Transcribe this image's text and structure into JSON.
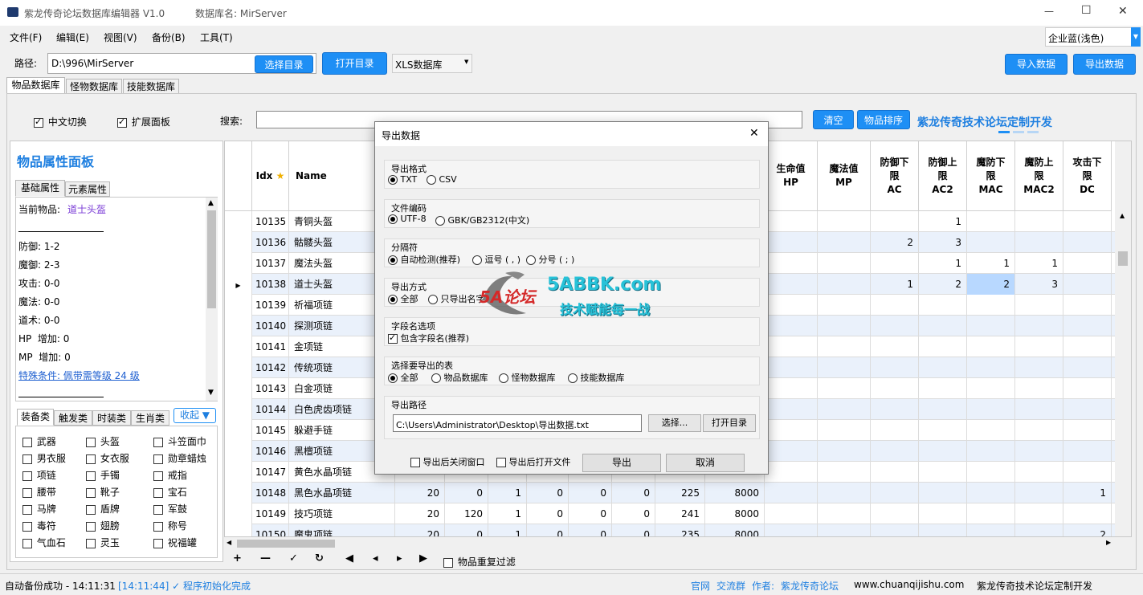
{
  "window": {
    "title": "紫龙传奇论坛数据库编辑器 V1.0",
    "db_label": "数据库名: MirServer",
    "min": "—",
    "max": "☐",
    "close": "✕"
  },
  "menu": [
    "文件(F)",
    "编辑(E)",
    "视图(V)",
    "备份(B)",
    "工具(T)"
  ],
  "theme": {
    "value": "企业蓝(浅色)",
    "accent": "#1e8ff5"
  },
  "toolbar": {
    "path_label": "路径:",
    "path_value": "D:\\996\\MirServer",
    "choose_dir": "选择目录",
    "open_dir": "打开目录",
    "db_type": "XLS数据库",
    "import": "导入数据",
    "export": "导出数据"
  },
  "tabs": [
    "物品数据库",
    "怪物数据库",
    "技能数据库"
  ],
  "options": {
    "cn_switch": "中文切换",
    "ext_panel": "扩展面板",
    "search_label": "搜索:",
    "clear": "清空",
    "sort": "物品排序",
    "promo": "紫龙传奇技术论坛定制开发"
  },
  "panel": {
    "title": "物品属性面板",
    "tabs": [
      "基础属性",
      "元素属性"
    ],
    "current_label": "当前物品:",
    "current_value": "道士头盔",
    "lines": [
      "防御: 1-2",
      "魔御: 2-3",
      "攻击: 0-0",
      "魔法: 0-0",
      "道术: 0-0",
      "HP  增加: 0",
      "MP  增加: 0"
    ],
    "special": "特殊条件: 佩带需等级 24 级",
    "cat_tabs": [
      "装备类",
      "触发类",
      "时装类",
      "生肖类"
    ],
    "collapse": "收起 ▼",
    "cats": [
      [
        "武器",
        "头盔",
        "斗笠面巾"
      ],
      [
        "男衣服",
        "女衣服",
        "勋章蜡烛"
      ],
      [
        "项链",
        "手镯",
        "戒指"
      ],
      [
        "腰带",
        "靴子",
        "宝石"
      ],
      [
        "马牌",
        "盾牌",
        "军鼓"
      ],
      [
        "毒符",
        "翅膀",
        "称号"
      ],
      [
        "气血石",
        "灵玉",
        "祝福罐"
      ]
    ]
  },
  "grid": {
    "idx_header": "Idx",
    "star": "★",
    "name_header": "Name",
    "right_headers": [
      "生命值\nHP",
      "魔法值\nMP",
      "防御下\n限\nAC",
      "防御上\n限\nAC2",
      "魔防下\n限\nMAC",
      "魔防上\n限\nMAC2",
      "攻击下\n限\nDC"
    ],
    "rows": [
      {
        "idx": "10135",
        "name": "青铜头盔",
        "c": [
          "",
          "",
          "",
          "",
          "",
          "",
          "",
          "",
          ""
        ],
        "r": [
          "",
          "",
          "",
          "1",
          "",
          "",
          ""
        ]
      },
      {
        "idx": "10136",
        "name": "骷髅头盔",
        "c": [
          "",
          "",
          "",
          "",
          "",
          "",
          "",
          "",
          ""
        ],
        "r": [
          "",
          "",
          "2",
          "3",
          "",
          "",
          ""
        ]
      },
      {
        "idx": "10137",
        "name": "魔法头盔",
        "c": [
          "",
          "",
          "",
          "",
          "",
          "",
          "",
          "",
          ""
        ],
        "r": [
          "",
          "",
          "",
          "1",
          "1",
          "1",
          ""
        ]
      },
      {
        "idx": "10138",
        "name": "道士头盔",
        "c": [
          "",
          "",
          "",
          "",
          "",
          "",
          "",
          "",
          ""
        ],
        "r": [
          "",
          "",
          "1",
          "2",
          "2",
          "3",
          ""
        ],
        "current": true
      },
      {
        "idx": "10139",
        "name": "祈福项链",
        "c": [
          "",
          "",
          "",
          "",
          "",
          "",
          "",
          "",
          ""
        ],
        "r": [
          "",
          "",
          "",
          "",
          "",
          "",
          ""
        ]
      },
      {
        "idx": "10140",
        "name": "探测项链",
        "c": [
          "",
          "",
          "",
          "",
          "",
          "",
          "",
          "",
          ""
        ],
        "r": [
          "",
          "",
          "",
          "",
          "",
          "",
          ""
        ]
      },
      {
        "idx": "10141",
        "name": "金项链",
        "c": [
          "",
          "",
          "",
          "",
          "",
          "",
          "",
          "",
          ""
        ],
        "r": [
          "",
          "",
          "",
          "",
          "",
          "",
          ""
        ]
      },
      {
        "idx": "10142",
        "name": "传统项链",
        "c": [
          "",
          "",
          "",
          "",
          "",
          "",
          "",
          "",
          ""
        ],
        "r": [
          "",
          "",
          "",
          "",
          "",
          "",
          ""
        ]
      },
      {
        "idx": "10143",
        "name": "白金项链",
        "c": [
          "",
          "",
          "",
          "",
          "",
          "",
          "",
          "",
          ""
        ],
        "r": [
          "",
          "",
          "",
          "",
          "",
          "",
          ""
        ]
      },
      {
        "idx": "10144",
        "name": "白色虎齿项链",
        "c": [
          "",
          "",
          "",
          "",
          "",
          "",
          "",
          "",
          ""
        ],
        "r": [
          "",
          "",
          "",
          "",
          "",
          "",
          ""
        ]
      },
      {
        "idx": "10145",
        "name": "躲避手链",
        "c": [
          "",
          "",
          "",
          "",
          "",
          "",
          "",
          "",
          ""
        ],
        "r": [
          "",
          "",
          "",
          "",
          "",
          "",
          ""
        ]
      },
      {
        "idx": "10146",
        "name": "黑檀项链",
        "c": [
          "",
          "",
          "",
          "",
          "",
          "",
          "",
          "",
          ""
        ],
        "r": [
          "",
          "",
          "",
          "",
          "",
          "",
          ""
        ]
      },
      {
        "idx": "10147",
        "name": "黄色水晶项链",
        "c": [
          "",
          "",
          "",
          "",
          "",
          "",
          "",
          "",
          ""
        ],
        "r": [
          "",
          "",
          "",
          "",
          "",
          "",
          ""
        ]
      },
      {
        "idx": "10148",
        "name": "黑色水晶项链",
        "c": [
          "20",
          "0",
          "1",
          "0",
          "0",
          "0",
          "225",
          "8000",
          ""
        ],
        "r": [
          "",
          "",
          "",
          "",
          "",
          "",
          "1"
        ]
      },
      {
        "idx": "10149",
        "name": "技巧项链",
        "c": [
          "20",
          "120",
          "1",
          "0",
          "0",
          "0",
          "241",
          "8000",
          ""
        ],
        "r": [
          "",
          "",
          "",
          "",
          "",
          "",
          ""
        ]
      },
      {
        "idx": "10150",
        "name": "魔鬼项链",
        "c": [
          "20",
          "0",
          "1",
          "0",
          "0",
          "0",
          "235",
          "8000",
          ""
        ],
        "r": [
          "",
          "",
          "",
          "",
          "",
          "",
          "2"
        ]
      }
    ]
  },
  "bottom_toolbar": {
    "buttons": [
      "+",
      "—",
      "✓",
      "↻",
      "◀",
      "◂",
      "▸",
      "▶"
    ],
    "dup_filter": "物品重复过滤"
  },
  "status": {
    "left": "自动备份成功 - 14:11:31",
    "log": "[14:11:44] ✓ 程序初始化完成",
    "links": [
      "官网",
      "交流群"
    ],
    "author": "作者:",
    "author_link": "紫龙传奇论坛",
    "site": "www.chuanqijishu.com",
    "promo": "紫龙传奇技术论坛定制开发"
  },
  "watermark": {
    "logo": "5A论坛",
    "site": "5ABBK.com",
    "slogan": "技术赋能每一战"
  },
  "dialog": {
    "title": "导出数据",
    "close": "✕",
    "format_label": "导出格式",
    "format_opts": [
      "TXT",
      "CSV"
    ],
    "enc_label": "文件编码",
    "enc_opts": [
      "UTF-8",
      "GBK/GB2312(中文)"
    ],
    "sep_label": "分隔符",
    "sep_opts": [
      "自动检测(推荐)",
      "逗号 ( , )",
      "分号 ( ; )"
    ],
    "mode_label": "导出方式",
    "mode_opts": [
      "全部",
      "只导出名字"
    ],
    "field_label": "字段名选项",
    "field_opt": "包含字段名(推荐)",
    "table_label": "选择要导出的表",
    "table_opts": [
      "全部",
      "物品数据库",
      "怪物数据库",
      "技能数据库"
    ],
    "path_label": "导出路径",
    "path_value": "C:\\Users\\Administrator\\Desktop\\导出数据.txt",
    "browse": "选择...",
    "open_dir": "打开目录",
    "close_after": "导出后关闭窗口",
    "open_after": "导出后打开文件",
    "export": "导出",
    "cancel": "取消"
  }
}
